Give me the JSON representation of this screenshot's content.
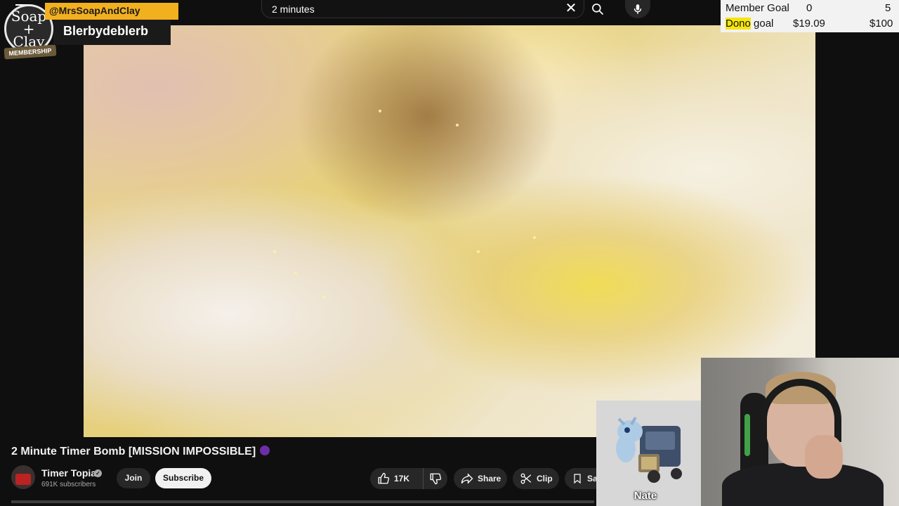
{
  "search": {
    "query": "2 minutes"
  },
  "stream_overlay": {
    "member_handle": "@MrsSoapAndClay",
    "member_name": "Blerbydeblerb",
    "membership_label": "MEMBERSHIP",
    "avatar_text": "Soap + Clay"
  },
  "goals": {
    "member_goal": {
      "label": "Member Goal",
      "current": "0",
      "target": "5"
    },
    "dono_goal": {
      "label_highlight": "Dono",
      "label_rest": " goal",
      "current": "$19.09",
      "target": "$100"
    }
  },
  "video": {
    "title": "2 Minute Timer Bomb [MISSION IMPOSSIBLE]",
    "channel_name": "Timer Topia",
    "subscribers": "691K subscribers",
    "join_label": "Join",
    "subscribe_label": "Subscribe",
    "like_count": "17K",
    "share_label": "Share",
    "clip_label": "Clip",
    "save_label": "Sa"
  },
  "streamer": {
    "name": "Nate"
  },
  "colors": {
    "goal_highlight": "#f6e60b",
    "handle_bg": "#f2b01e"
  }
}
